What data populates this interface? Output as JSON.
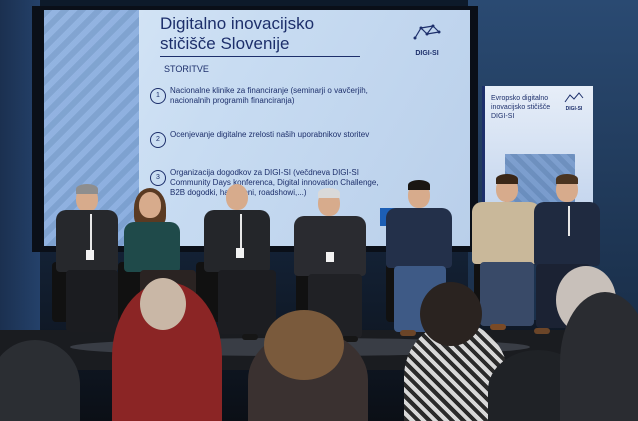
{
  "screen": {
    "title_line1": "Digitalno inovacijsko",
    "title_line2": "stičišče Slovenije",
    "logo_text": "DIGI-SI",
    "section": "STORITVE",
    "services": [
      {
        "num": "1",
        "text": "Nacionalne klinike za financiranje (seminarji o vavčerjih, nacionalnih programih financiranja)"
      },
      {
        "num": "2",
        "text": "Ocenjevanje digitalne zrelosti naših uporabnikov storitev"
      },
      {
        "num": "3",
        "text": "Organizacija dogodkov za DIGI-SI (večdneva DIGI-SI Community Days konferenca, Digital innovation Challenge, B2B dogodki, hackatoni, roadshowi,...)"
      }
    ],
    "footer_mark": "NK"
  },
  "banner": {
    "text": "Evropsko digitalno inovacijsko stičišče DIGI-SI",
    "logo_text": "DIGI-SI"
  },
  "colors": {
    "screen_text": "#1d2f6b",
    "screen_bg": "#c8dcf2",
    "stage": "#1a1c20"
  }
}
